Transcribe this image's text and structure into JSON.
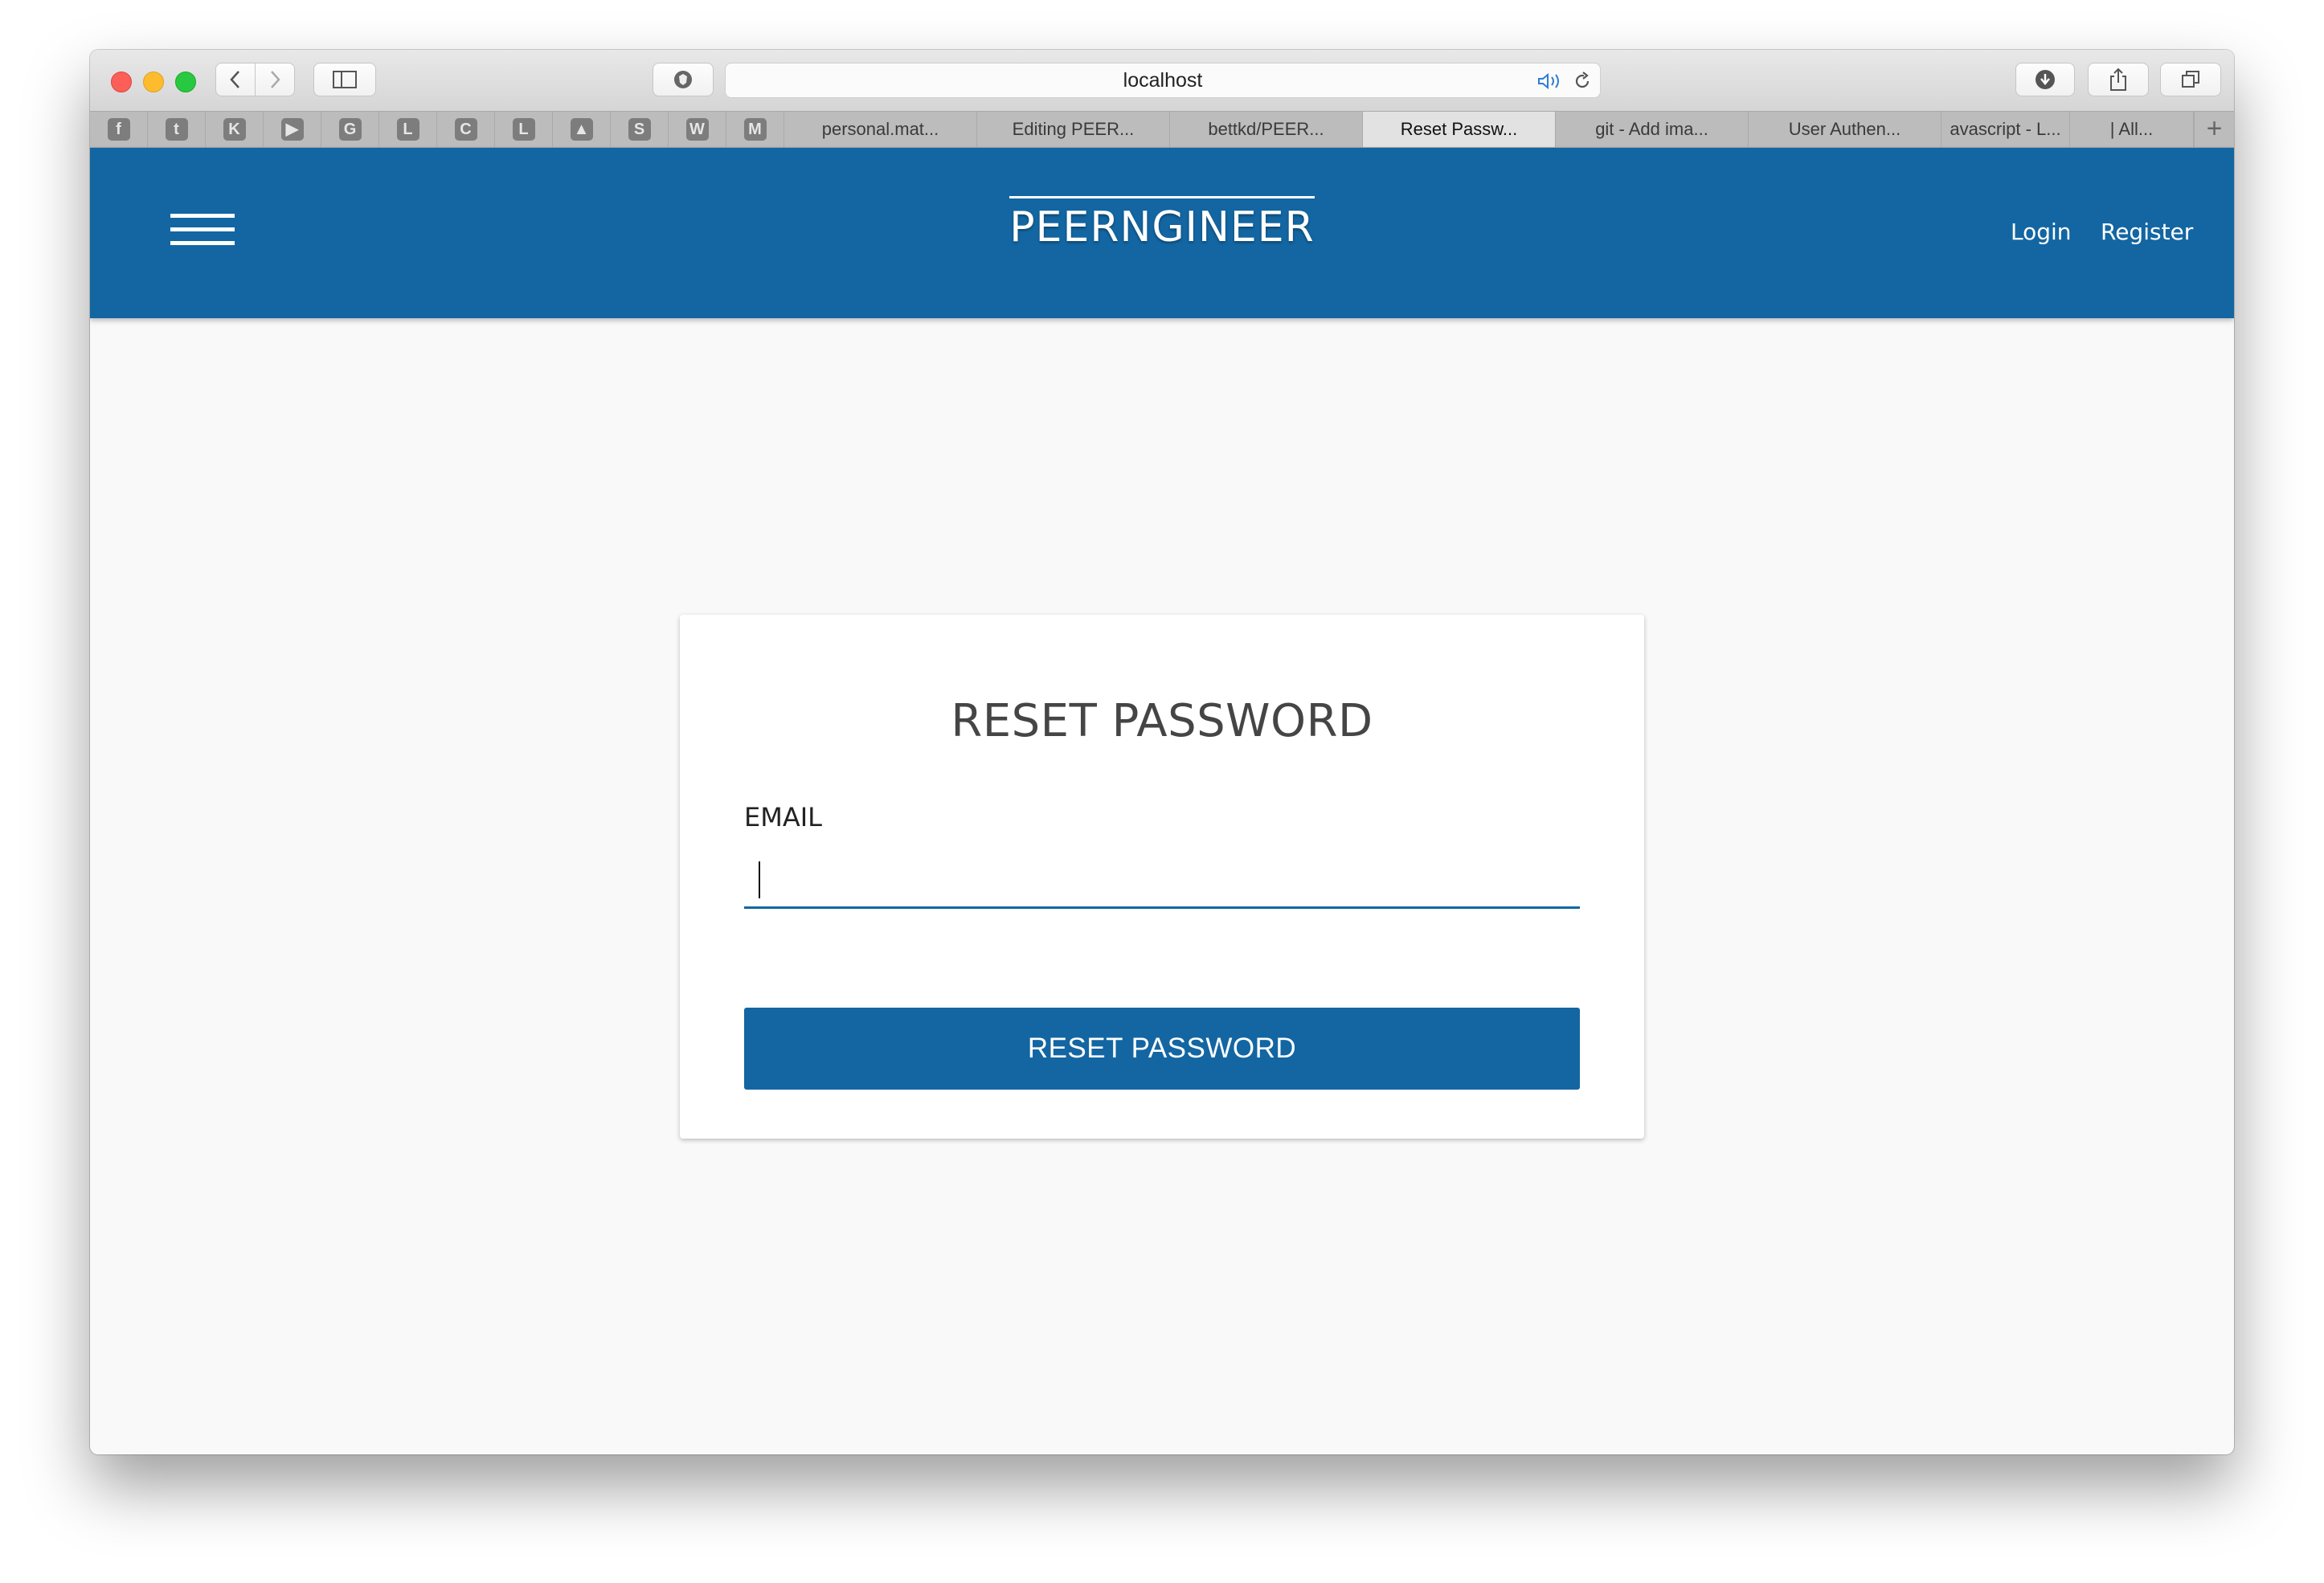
{
  "browser": {
    "url": "localhost",
    "pinned_tabs": [
      {
        "glyph": "f",
        "icon": "facebook-icon"
      },
      {
        "glyph": "t",
        "icon": "twitter-icon"
      },
      {
        "glyph": "K",
        "icon": "k-icon"
      },
      {
        "glyph": "▶",
        "icon": "youtube-icon"
      },
      {
        "glyph": "G",
        "icon": "g-icon"
      },
      {
        "glyph": "L",
        "icon": "l-icon"
      },
      {
        "glyph": "C",
        "icon": "c-icon"
      },
      {
        "glyph": "L",
        "icon": "l-icon"
      },
      {
        "glyph": "▲",
        "icon": "drive-icon"
      },
      {
        "glyph": "S",
        "icon": "s-icon"
      },
      {
        "glyph": "W",
        "icon": "w-icon"
      },
      {
        "glyph": "M",
        "icon": "m-icon"
      }
    ],
    "tabs": [
      {
        "label": "personal.mat..."
      },
      {
        "label": "Editing PEER..."
      },
      {
        "label": "bettkd/PEER..."
      },
      {
        "label": "Reset Passw...",
        "active": true
      },
      {
        "label": "git - Add ima..."
      },
      {
        "label": "User Authen..."
      },
      {
        "label": "avascript - L..."
      },
      {
        "label": "| All..."
      }
    ],
    "new_tab_label": "+"
  },
  "nav": {
    "brand": "PEERNGINEER",
    "login": "Login",
    "register": "Register"
  },
  "form": {
    "title": "RESET PASSWORD",
    "email_label": "EMAIL",
    "email_value": "",
    "submit_label": "RESET PASSWORD"
  },
  "colors": {
    "primary": "#1366a2",
    "background": "#f9f9f9"
  }
}
